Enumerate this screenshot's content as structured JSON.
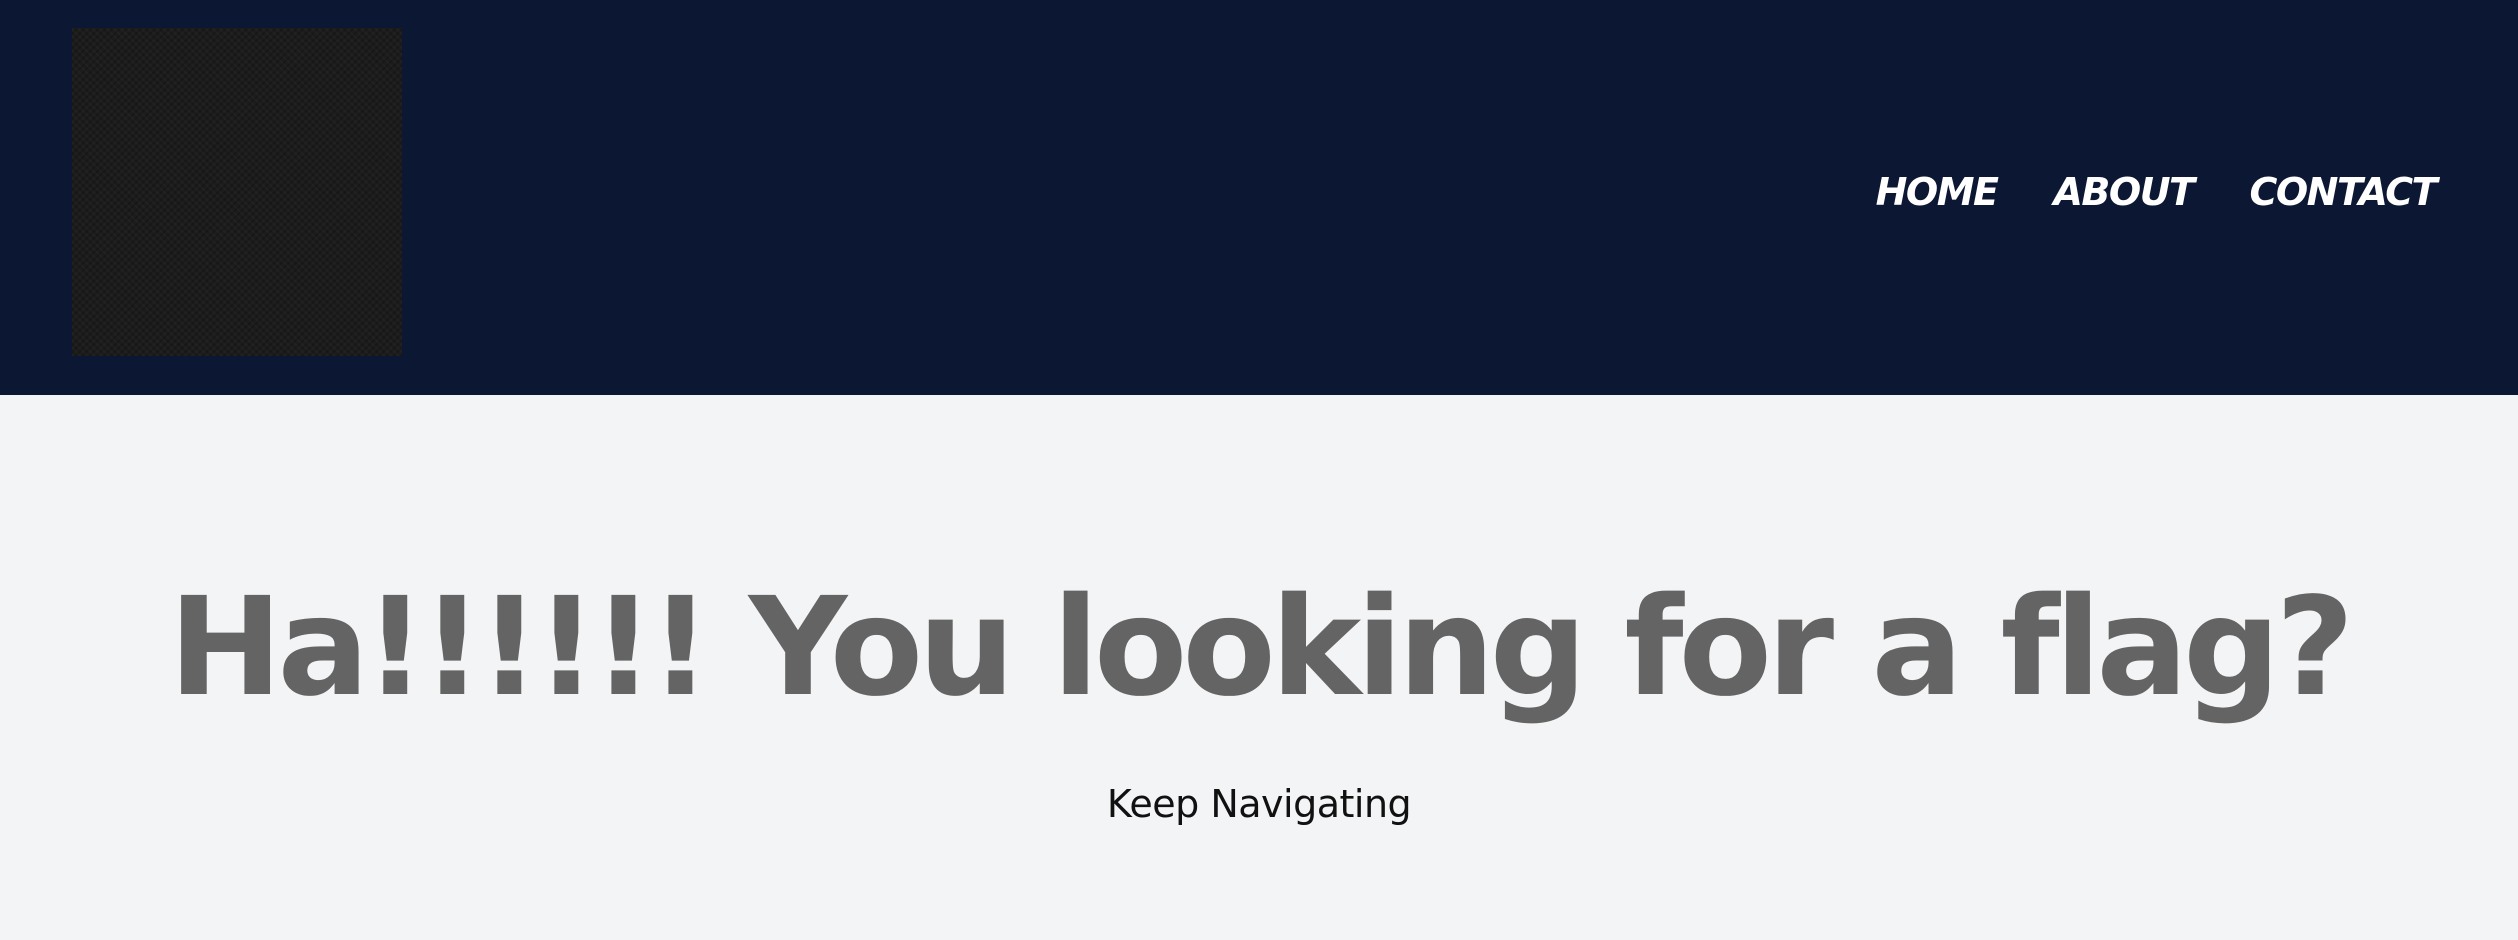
{
  "header": {
    "background_color": "#0c1733",
    "nav": {
      "home": "HOME",
      "about": "ABOUT",
      "contact": "CONTACT"
    }
  },
  "main": {
    "background_color": "#f3f4f6",
    "headline": "Ha!!!!!! You looking for a flag?",
    "subline": "Keep Navigating"
  }
}
